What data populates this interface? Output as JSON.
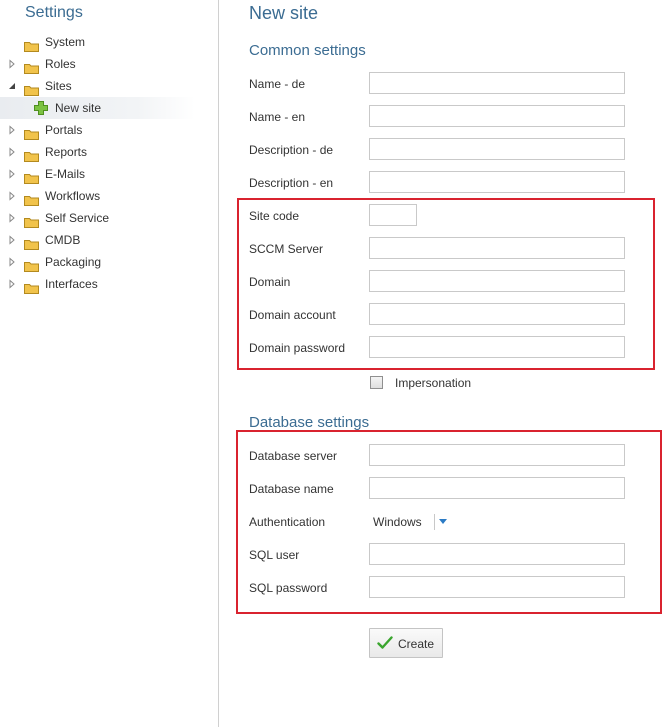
{
  "sidebar": {
    "title": "Settings",
    "items": [
      {
        "label": "System"
      },
      {
        "label": "Roles"
      },
      {
        "label": "Sites"
      },
      {
        "label": "New site"
      },
      {
        "label": "Portals"
      },
      {
        "label": "Reports"
      },
      {
        "label": "E-Mails"
      },
      {
        "label": "Workflows"
      },
      {
        "label": "Self Service"
      },
      {
        "label": "CMDB"
      },
      {
        "label": "Packaging"
      },
      {
        "label": "Interfaces"
      }
    ]
  },
  "form": {
    "title": "New site",
    "common_section": "Common settings",
    "name_de": "Name - de",
    "name_en": "Name - en",
    "description_de": "Description - de",
    "description_en": "Description - en",
    "site_code": "Site code",
    "sccm_server": "SCCM Server",
    "domain": "Domain",
    "domain_account": "Domain account",
    "domain_password": "Domain password",
    "impersonation": "Impersonation",
    "impersonation_checked": false,
    "database_section": "Database settings",
    "database_server": "Database server",
    "database_name": "Database name",
    "authentication": "Authentication",
    "authentication_value": "Windows",
    "sql_user": "SQL user",
    "sql_password": "SQL password",
    "create_button": "Create"
  },
  "colors": {
    "accent": "#3b6c92",
    "highlight_box": "#d9232f",
    "dropdown_arrow": "#2b7bc5",
    "check_icon": "#3aa52e",
    "plus_icon": "#7cc242",
    "folder": "#f1c34b"
  }
}
